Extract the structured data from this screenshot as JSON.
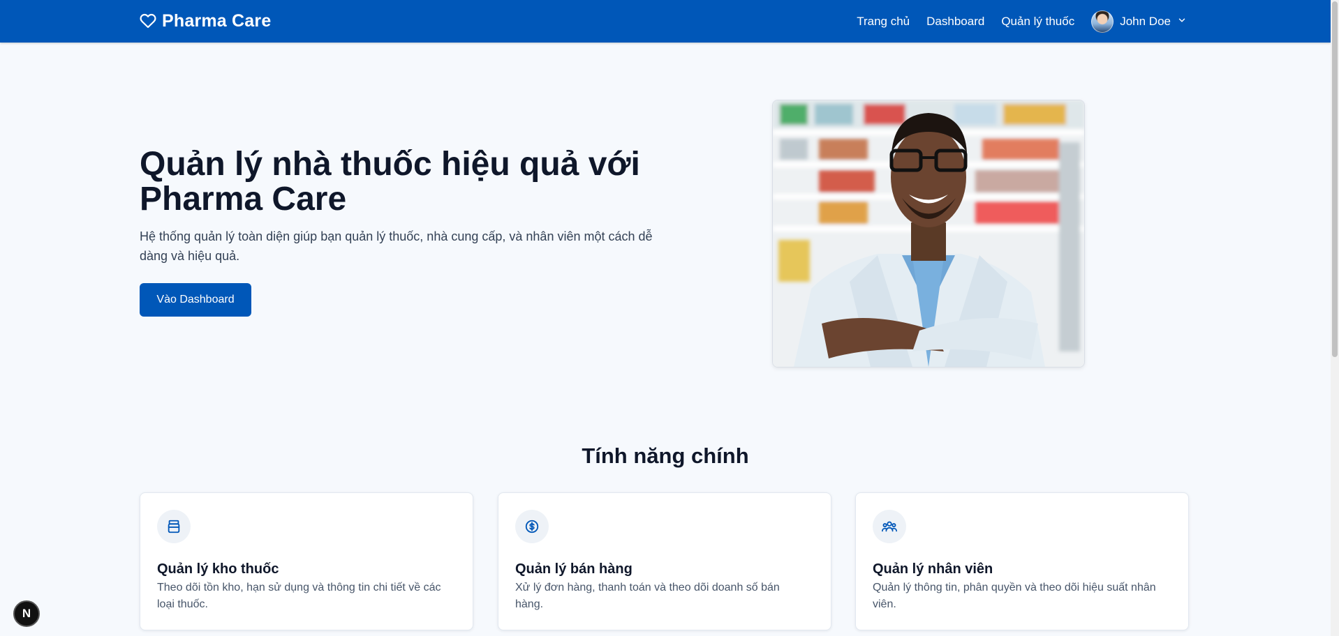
{
  "nav": {
    "brand": "Pharma Care",
    "links": [
      "Trang chủ",
      "Dashboard",
      "Quản lý thuốc"
    ],
    "user_name": "John Doe"
  },
  "hero": {
    "title": "Quản lý nhà thuốc hiệu quả với Pharma Care",
    "description": "Hệ thống quản lý toàn diện giúp bạn quản lý thuốc, nhà cung cấp, và nhân viên một cách dễ dàng và hiệu quả.",
    "cta_label": "Vào Dashboard"
  },
  "features": {
    "title": "Tính năng chính",
    "cards": [
      {
        "icon": "pill-bottle-icon",
        "title": "Quản lý kho thuốc",
        "description": "Theo dõi tồn kho, hạn sử dụng và thông tin chi tiết về các loại thuốc."
      },
      {
        "icon": "dollar-circle-icon",
        "title": "Quản lý bán hàng",
        "description": "Xử lý đơn hàng, thanh toán và theo dõi doanh số bán hàng."
      },
      {
        "icon": "users-icon",
        "title": "Quản lý nhân viên",
        "description": "Quản lý thông tin, phân quyền và theo dõi hiệu suất nhân viên."
      }
    ]
  },
  "dev_badge": "N",
  "colors": {
    "primary": "#0057b8",
    "background": "#f6f9fd",
    "heading": "#0f172a"
  }
}
